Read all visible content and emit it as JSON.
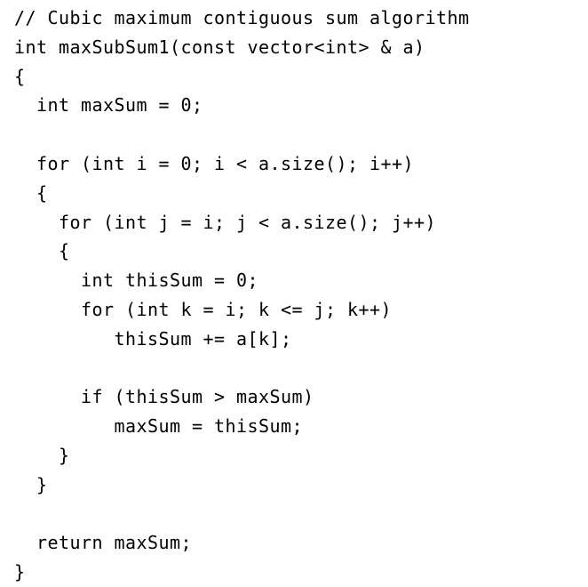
{
  "document": {
    "kind": "code-listing",
    "language": "C++",
    "title": "Cubic maximum contiguous sum algorithm",
    "background_color": "#ffffff",
    "text_color": "#000000"
  },
  "code": {
    "lines": [
      "// Cubic maximum contiguous sum algorithm",
      "int maxSubSum1(const vector<int> & a)",
      "{",
      "  int maxSum = 0;",
      "",
      "  for (int i = 0; i < a.size(); i++)",
      "  {",
      "    for (int j = i; j < a.size(); j++)",
      "    {",
      "      int thisSum = 0;",
      "      for (int k = i; k <= j; k++)",
      "         thisSum += a[k];",
      "",
      "      if (thisSum > maxSum)",
      "         maxSum = thisSum;",
      "    }",
      "  }",
      "",
      "  return maxSum;",
      "}"
    ]
  }
}
